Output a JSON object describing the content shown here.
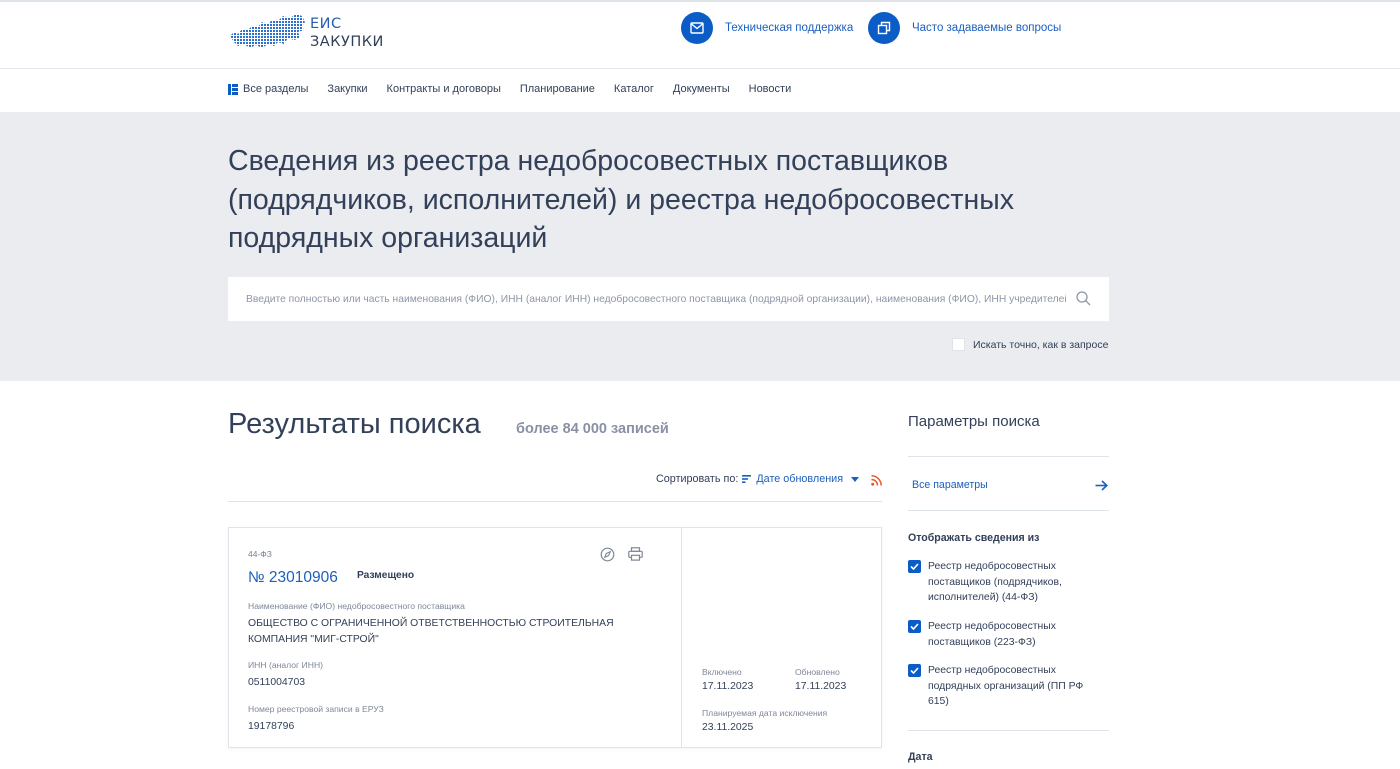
{
  "header": {
    "logo_line1": "ЕИС",
    "logo_line2": "ЗАКУПКИ",
    "support_label": "Техническая поддержка",
    "faq_label": "Часто задаваемые вопросы"
  },
  "nav": {
    "items": [
      {
        "label": "Все разделы"
      },
      {
        "label": "Закупки"
      },
      {
        "label": "Контракты и договоры"
      },
      {
        "label": "Планирование"
      },
      {
        "label": "Каталог"
      },
      {
        "label": "Документы"
      },
      {
        "label": "Новости"
      }
    ]
  },
  "hero": {
    "title": "Сведения из реестра недобросовестных поставщиков (подрядчиков, исполнителей) и реестра недобросовестных подрядных организаций",
    "search_placeholder": "Введите полностью или часть наименования (ФИО), ИНН (аналог ИНН) недобросовестного поставщика (подрядной организации), наименования (ФИО), ИНН учредителей...",
    "search_value": "",
    "exact_label": "Искать точно, как в запросе",
    "exact_checked": false
  },
  "results": {
    "title": "Результаты поиска",
    "count": "более 84 000 записей",
    "sort_label": "Сортировать по:",
    "sort_value": "Дате обновления",
    "items": [
      {
        "law": "44-ФЗ",
        "number": "№ 23010906",
        "status": "Размещено",
        "name_label": "Наименование (ФИО) недобросовестного поставщика",
        "name_value": "ОБЩЕСТВО С ОГРАНИЧЕННОЙ ОТВЕТСТВЕННОСТЬЮ СТРОИТЕЛЬНАЯ КОМПАНИЯ \"МИГ-СТРОЙ\"",
        "inn_label": "ИНН (аналог ИНН)",
        "inn_value": "0511004703",
        "eruz_label": "Номер реестровой записи в ЕРУЗ",
        "eruz_value": "19178796",
        "included_label": "Включено",
        "included_value": "17.11.2023",
        "updated_label": "Обновлено",
        "updated_value": "17.11.2023",
        "exclusion_label": "Планируемая дата исключения",
        "exclusion_value": "23.11.2025"
      }
    ]
  },
  "sidebar": {
    "title": "Параметры поиска",
    "all_params": "Все параметры",
    "show_heading": "Отображать сведения из",
    "options": [
      {
        "label": "Реестр недобросовестных поставщиков (подрядчиков, исполнителей) (44-ФЗ)",
        "checked": true
      },
      {
        "label": "Реестр недобросовестных поставщиков (223-ФЗ)",
        "checked": true
      },
      {
        "label": "Реестр недобросовестных подрядных организаций (ПП РФ 615)",
        "checked": true
      }
    ],
    "date_heading": "Дата"
  },
  "colors": {
    "accent": "#0b5cc7",
    "link": "#1c5fbd",
    "text": "#334059",
    "hero_bg": "#eaecf0",
    "rss": "#e8552a"
  },
  "icons": {
    "support": "mail-icon",
    "faq": "copy-icon",
    "all_sections": "grid-menu-icon",
    "search": "search-icon",
    "sort": "sort-icon",
    "rss": "rss-icon",
    "compass": "compass-icon",
    "print": "print-icon",
    "arrow": "arrow-right-icon"
  }
}
